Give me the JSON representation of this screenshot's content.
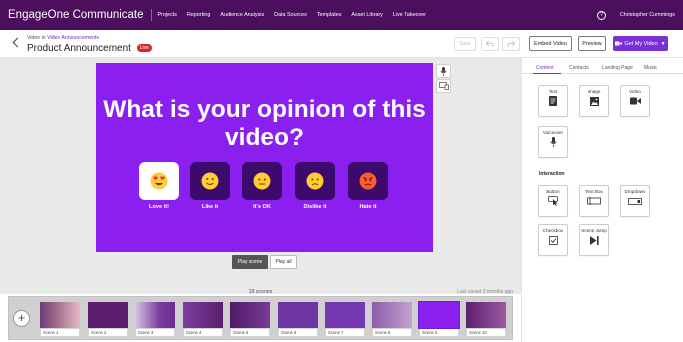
{
  "app": {
    "brand": "EngageOne Communicate",
    "nav": [
      "Projects",
      "Reporting",
      "Audience Analysis",
      "Data Sources",
      "Templates",
      "Asset Library",
      "Live Takeover"
    ],
    "user": "Christopher Cummings"
  },
  "header": {
    "crumb_prefix": "Video in",
    "crumb_link": "Video Announcements",
    "title": "Product Announcement",
    "live_badge": "Live",
    "save_label": "Save",
    "embed_label": "Embed Video",
    "preview_label": "Preview",
    "get_video_label": "Get My Video"
  },
  "slide": {
    "question": "What is your opinion of this video?",
    "options": [
      {
        "label": "Love it!",
        "emoji": "heart-eyes-face",
        "selected": true
      },
      {
        "label": "Like it",
        "emoji": "smiling-face",
        "selected": false
      },
      {
        "label": "It's OK",
        "emoji": "neutral-face",
        "selected": false
      },
      {
        "label": "Dislike it",
        "emoji": "frowning-face",
        "selected": false
      },
      {
        "label": "Hate it",
        "emoji": "angry-face",
        "selected": false
      }
    ]
  },
  "controls": {
    "play_scene": "Play scene",
    "play_all": "Play all",
    "scenes_count": "18 scenes",
    "last_saved": "Last saved 3 months ago"
  },
  "scenes": [
    {
      "label": "Scene 1"
    },
    {
      "label": "Scene 2"
    },
    {
      "label": "Scene 3"
    },
    {
      "label": "Scene 4"
    },
    {
      "label": "Scene 5"
    },
    {
      "label": "Scene 6"
    },
    {
      "label": "Scene 7"
    },
    {
      "label": "Scene 8"
    },
    {
      "label": "Scene 9",
      "active": true
    },
    {
      "label": "Scene 10"
    }
  ],
  "panel": {
    "tabs": [
      "Content",
      "Contacts",
      "Landing Page",
      "Music"
    ],
    "active_tab": "Content",
    "content_tiles": [
      {
        "label": "Text",
        "icon": "text-doc-icon"
      },
      {
        "label": "Image",
        "icon": "image-icon"
      },
      {
        "label": "Video",
        "icon": "video-camera-icon"
      },
      {
        "label": "Voiceover",
        "icon": "microphone-icon"
      }
    ],
    "interaction_title": "Interaction",
    "interaction_tiles": [
      {
        "label": "Button",
        "icon": "button-pointer-icon"
      },
      {
        "label": "Text Box",
        "icon": "text-box-icon"
      },
      {
        "label": "Dropdown",
        "icon": "dropdown-icon"
      },
      {
        "label": "Checkbox",
        "icon": "checkbox-icon"
      },
      {
        "label": "Scene Jump",
        "icon": "scene-jump-icon"
      }
    ]
  },
  "colors": {
    "nav_bg": "#4b0f5e",
    "slide_bg": "#8a1ff0",
    "accent": "#7b2fd6",
    "live_red": "#d9262a"
  }
}
